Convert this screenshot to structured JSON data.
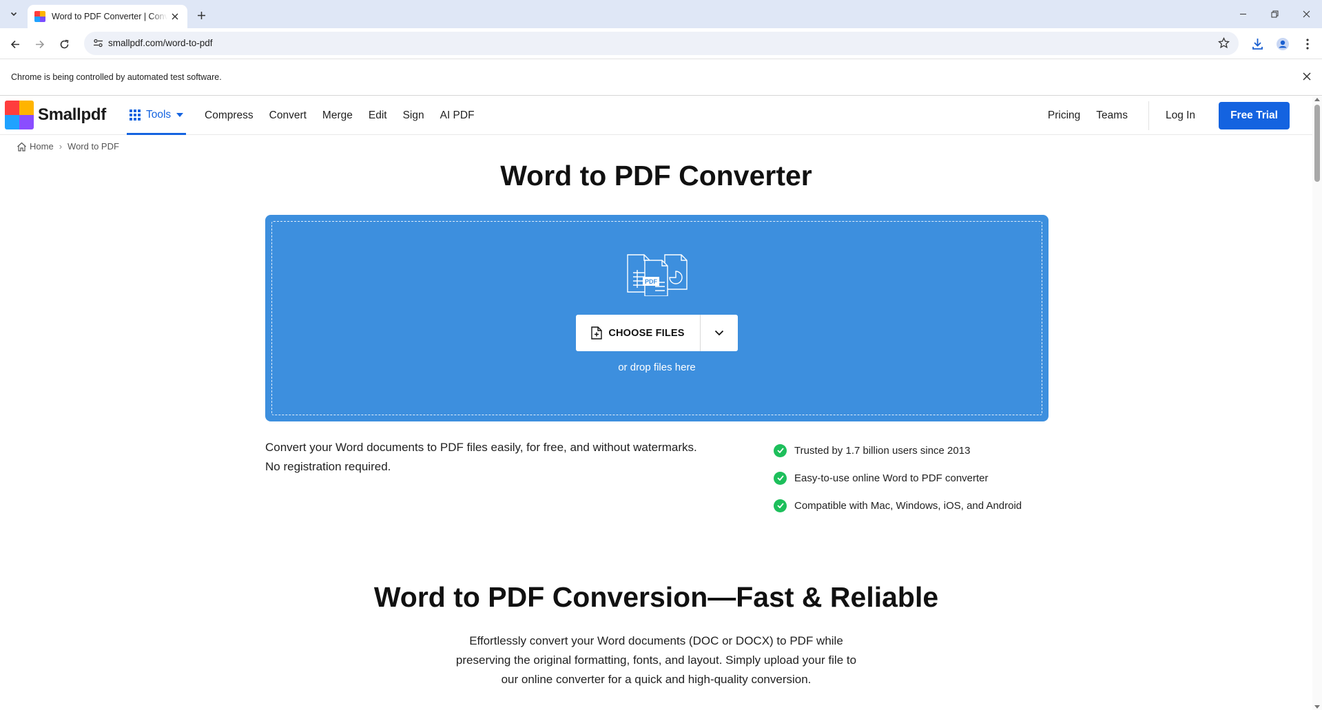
{
  "browser": {
    "tab_title": "Word to PDF Converter | Convert Word to PDF",
    "url": "smallpdf.com/word-to-pdf",
    "infobar_message": "Chrome is being controlled by automated test software."
  },
  "header": {
    "logo_text": "Smallpdf",
    "tools_label": "Tools",
    "nav": [
      "Compress",
      "Convert",
      "Merge",
      "Edit",
      "Sign",
      "AI PDF"
    ],
    "pricing": "Pricing",
    "teams": "Teams",
    "login": "Log In",
    "free_trial": "Free Trial"
  },
  "breadcrumb": {
    "home": "Home",
    "current": "Word to PDF"
  },
  "hero": {
    "title": "Word to PDF Converter",
    "choose_files": "CHOOSE FILES",
    "drop_hint": "or drop files here",
    "illustration_label": "PDF"
  },
  "description": {
    "line1": "Convert your Word documents to PDF files easily, for free, and without watermarks.",
    "line2": "No registration required."
  },
  "features": [
    "Trusted by 1.7 billion users since 2013",
    "Easy-to-use online Word to PDF converter",
    "Compatible with Mac, Windows, iOS, and Android"
  ],
  "section2": {
    "title": "Word to PDF Conversion—Fast & Reliable",
    "para_line1": "Effortlessly convert your Word documents (DOC or DOCX) to PDF while",
    "para_line2": "preserving the original formatting, fonts, and layout. Simply upload your file to",
    "para_line3": "our online converter for a quick and high-quality conversion."
  },
  "colors": {
    "brand_blue": "#1463e0",
    "dropzone_blue": "#3d8fde",
    "check_green": "#1dbf5b"
  }
}
